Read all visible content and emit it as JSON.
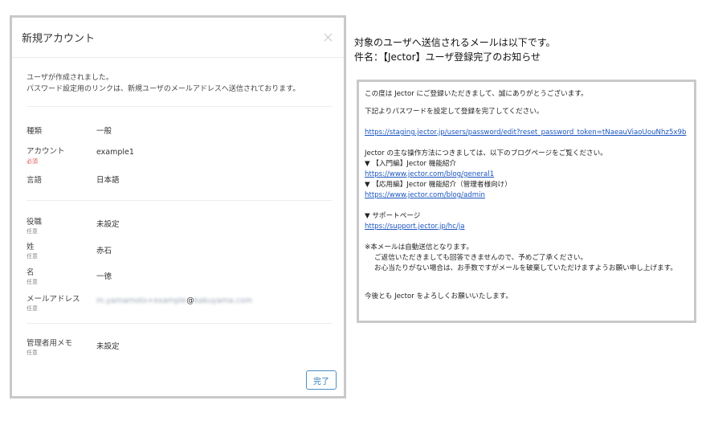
{
  "modal": {
    "title": "新規アカウント",
    "message_line1": "ユーザが作成されました。",
    "message_line2": "パスワード設定用のリンクは、新規ユーザのメールアドレスへ送信されております。",
    "rows": {
      "type": {
        "label": "種類",
        "value": "一般"
      },
      "account": {
        "label": "アカウント",
        "sub": "必須",
        "value": "example1"
      },
      "language": {
        "label": "言語",
        "value": "日本語"
      },
      "position": {
        "label": "役職",
        "sub": "任意",
        "value": "未設定"
      },
      "lastname": {
        "label": "姓",
        "sub": "任意",
        "value": "赤石"
      },
      "firstname": {
        "label": "名",
        "sub": "任意",
        "value": "一徳"
      },
      "email": {
        "label": "メールアドレス",
        "sub": "任意",
        "value_local": "m.yamamoto+example",
        "value_at": "@",
        "value_domain": "kakuyama.com"
      },
      "memo": {
        "label": "管理者用メモ",
        "sub": "任意",
        "value": "未設定"
      }
    },
    "done_label": "完了"
  },
  "intro": {
    "line1": "対象のユーザへ送信されるメールは以下です。",
    "line2": "件名：【Jector】ユーザ登録完了のお知らせ"
  },
  "email": {
    "greeting": "この度は Jector にご登録いただきまして、誠にありがとうございます。",
    "instruction": "下記よりパスワードを設定して登録を完了してください。",
    "reset_link": "https://staging.jector.jp/users/password/edit?reset_password_token=tNaeauViaoUouNhz5x9b",
    "blog_intro": "Jector の主な操作方法につきましては、以下のブログページをご覧ください。",
    "intro_blog_title": "▼ 【入門編】Jector 機能紹介",
    "intro_blog_link": "https://www.jector.com/blog/general1",
    "advanced_blog_title": "▼ 【応用編】Jector 機能紹介（管理者様向け）",
    "advanced_blog_link": "https://www.jector.com/blog/admin",
    "support_title": "▼ サポートページ",
    "support_link": "https://support.jector.jp/hc/ja",
    "note_line1": "※本メールは自動送信となります。",
    "note_line2": "ご返信いただきましても回答できませんので、予めご了承ください。",
    "note_line3": "お心当たりがない場合は、お手数ですがメールを破棄していただけますようお願い申し上げます。",
    "closing": "今後とも Jector をよろしくお願いいたします。"
  }
}
